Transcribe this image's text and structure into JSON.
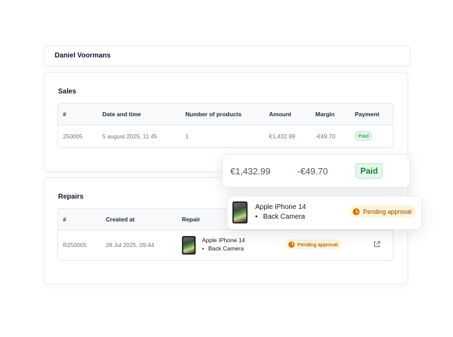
{
  "customer": {
    "name": "Daniel Voormans"
  },
  "sales": {
    "title": "Sales",
    "columns": [
      "#",
      "Date and time",
      "Number of products",
      "Amount",
      "Margin",
      "Payment"
    ],
    "rows": [
      {
        "id": "250005",
        "datetime": "5 august 2025, 11:45",
        "products": "1",
        "amount": "€1,432.99",
        "margin": "-€49.70",
        "payment": "Paid"
      }
    ]
  },
  "repairs": {
    "title": "Repairs",
    "columns": [
      "#",
      "Created at",
      "Repair"
    ],
    "rows": [
      {
        "id": "R250005",
        "created": "28 Jul 2025, 09:44",
        "device": "Apple iPhone 14",
        "part": "Back Camera",
        "status": "Pending approval",
        "action_icon": "external-link-icon"
      }
    ]
  },
  "popup_amount": {
    "amount": "€1,432.99",
    "margin": "-€49.70",
    "status": "Paid"
  },
  "popup_repair": {
    "device": "Apple iPhone 14",
    "part": "Back Camera",
    "status": "Pending approval"
  },
  "colors": {
    "paid_green": "#15803d",
    "pending_amber": "#d97706",
    "pending_bg": "#fdf4d6"
  }
}
